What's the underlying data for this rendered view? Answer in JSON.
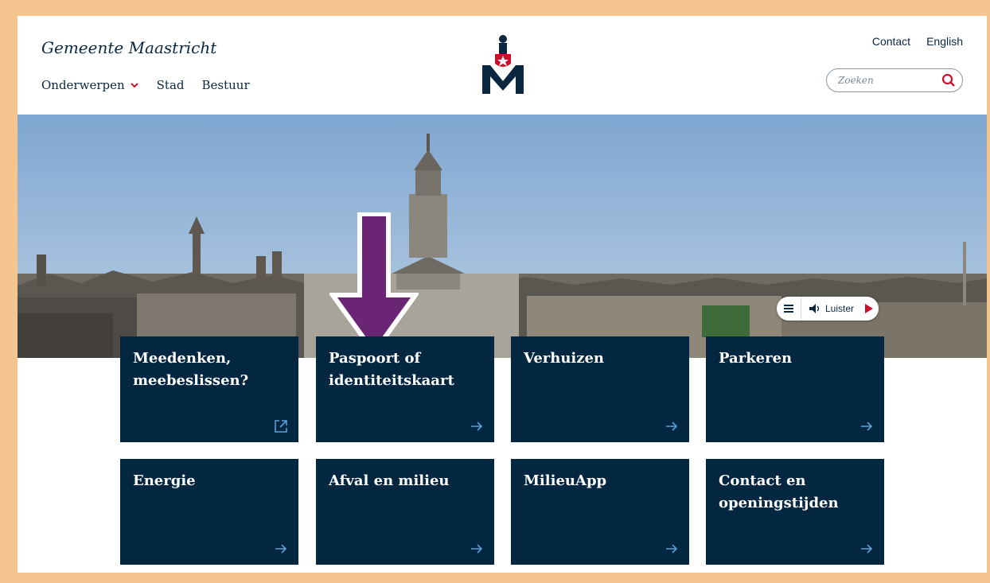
{
  "header": {
    "site_name": "Gemeente Maastricht",
    "nav": [
      {
        "label": "Onderwerpen",
        "has_dropdown": true
      },
      {
        "label": "Stad"
      },
      {
        "label": "Bestuur"
      }
    ],
    "utility_links": [
      "Contact",
      "English"
    ],
    "search": {
      "placeholder": "Zoeken"
    }
  },
  "hero": {
    "listen_label": "Luister"
  },
  "tiles": [
    {
      "title": "Meedenken, meebeslissen?",
      "icon": "external-link-icon"
    },
    {
      "title": "Paspoort of identiteitskaart",
      "icon": "arrow-right-icon"
    },
    {
      "title": "Verhuizen",
      "icon": "arrow-right-icon"
    },
    {
      "title": "Parkeren",
      "icon": "arrow-right-icon"
    },
    {
      "title": "Energie",
      "icon": "arrow-right-icon"
    },
    {
      "title": "Afval en milieu",
      "icon": "arrow-right-icon"
    },
    {
      "title": "MilieuApp",
      "icon": "arrow-right-icon"
    },
    {
      "title": "Contact en openingstijden",
      "icon": "arrow-right-icon"
    }
  ],
  "colors": {
    "tile_bg": "#032641",
    "accent_red": "#c8102e",
    "annotation_arrow": "#6b2575",
    "page_border": "#f4c58e"
  }
}
